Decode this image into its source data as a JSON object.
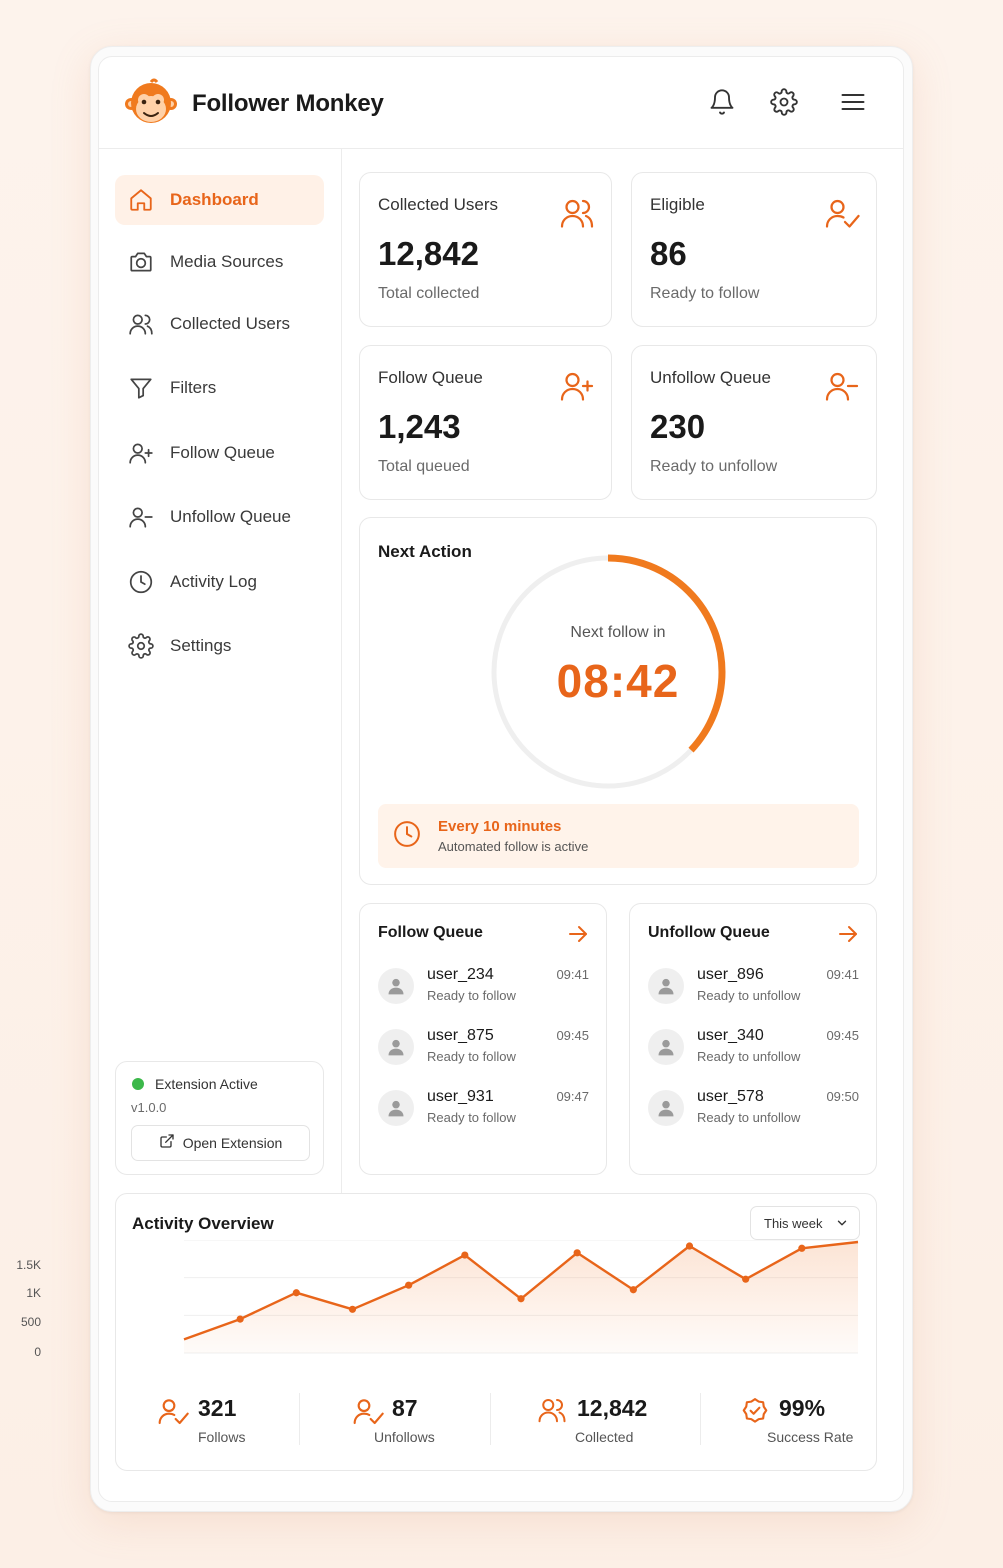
{
  "app": {
    "title": "Follower Monkey"
  },
  "header": {
    "icons": [
      "bell-icon",
      "gear-icon",
      "menu-icon"
    ]
  },
  "sidebar": {
    "items": [
      {
        "label": "Dashboard",
        "icon": "home-icon",
        "active": true
      },
      {
        "label": "Media Sources",
        "icon": "camera-icon"
      },
      {
        "label": "Collected Users",
        "icon": "users-icon"
      },
      {
        "label": "Filters",
        "icon": "filter-icon"
      },
      {
        "label": "Follow Queue",
        "icon": "user-plus-icon"
      },
      {
        "label": "Unfollow Queue",
        "icon": "user-minus-icon"
      },
      {
        "label": "Activity Log",
        "icon": "clock-icon"
      },
      {
        "label": "Settings",
        "icon": "gear-icon"
      }
    ],
    "extension": {
      "status": "Extension Active",
      "version": "v1.0.0",
      "button_label": "Open Extension"
    }
  },
  "stats": [
    {
      "title": "Collected Users",
      "value": "12,842",
      "sub": "Total collected",
      "icon": "users-icon"
    },
    {
      "title": "Eligible",
      "value": "86",
      "sub": "Ready to follow",
      "icon": "user-check-icon"
    },
    {
      "title": "Follow Queue",
      "value": "1,243",
      "sub": "Total queued",
      "icon": "user-plus-icon"
    },
    {
      "title": "Unfollow Queue",
      "value": "230",
      "sub": "Ready to unfollow",
      "icon": "user-minus-icon"
    }
  ],
  "next_action": {
    "title": "Next Action",
    "label": "Next follow in",
    "timer": "08:42",
    "progress": 0.37,
    "notice_title": "Every 10 minutes",
    "notice_sub": "Automated follow is active"
  },
  "follow_queue": {
    "title": "Follow Queue",
    "rows": [
      {
        "user": "user_234",
        "status": "Ready to follow",
        "time": "09:41"
      },
      {
        "user": "user_875",
        "status": "Ready to follow",
        "time": "09:45"
      },
      {
        "user": "user_931",
        "status": "Ready to follow",
        "time": "09:47"
      }
    ]
  },
  "unfollow_queue": {
    "title": "Unfollow Queue",
    "rows": [
      {
        "user": "user_896",
        "status": "Ready to unfollow",
        "time": "09:41"
      },
      {
        "user": "user_340",
        "status": "Ready to unfollow",
        "time": "09:45"
      },
      {
        "user": "user_578",
        "status": "Ready to unfollow",
        "time": "09:50"
      }
    ]
  },
  "activity": {
    "title": "Activity Overview",
    "range": "This week",
    "summary": [
      {
        "value": "321",
        "label": "Follows",
        "icon": "user-check-icon"
      },
      {
        "value": "87",
        "label": "Unfollows",
        "icon": "user-check-icon"
      },
      {
        "value": "12,842",
        "label": "Collected",
        "icon": "users-icon"
      },
      {
        "value": "99%",
        "label": "Success Rate",
        "icon": "shield-check-icon"
      }
    ]
  },
  "colors": {
    "accent": "#e8651a",
    "accent_light": "#fff1e7",
    "success": "#3cb84a"
  },
  "chart_data": {
    "type": "area",
    "y_tick_labels": [
      "1.5K",
      "1K",
      "500",
      "0"
    ],
    "ylim": [
      0,
      1500
    ],
    "values": [
      180,
      450,
      800,
      580,
      900,
      1300,
      720,
      1330,
      840,
      1420,
      980,
      1390,
      1800
    ]
  }
}
